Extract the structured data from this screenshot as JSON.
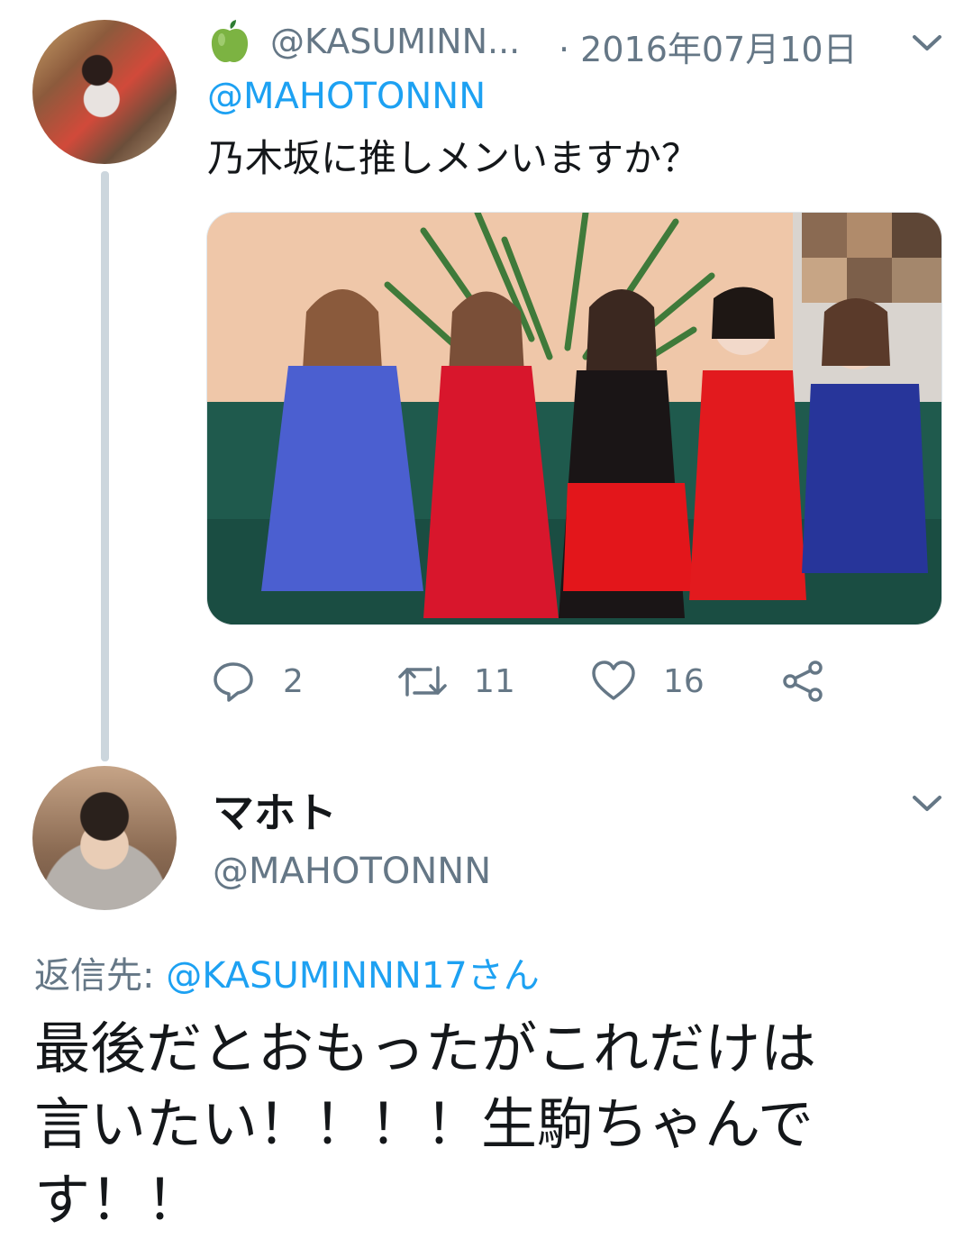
{
  "tweet1": {
    "handle": "@KASUMINN...",
    "date": "· 2016年07月10日",
    "reply_to": "@MAHOTONNN",
    "text": "乃木坂に推しメンいますか？",
    "emoji_icon": "green-apple-icon",
    "actions": {
      "reply_count": "2",
      "retweet_count": "11",
      "like_count": "16"
    }
  },
  "tweet2": {
    "display_name": "マホト",
    "handle": "@MAHOTONNN",
    "replying_label": "返信先:",
    "replying_to": "@KASUMINNN17さん",
    "text_lines": [
      "最後だとおもったがこれだけは",
      "言いたい！！！！生駒ちゃんで",
      "す！！"
    ]
  },
  "colors": {
    "link": "#1da1f2",
    "secondary": "#657786",
    "thread_line": "#ccd6dd"
  }
}
